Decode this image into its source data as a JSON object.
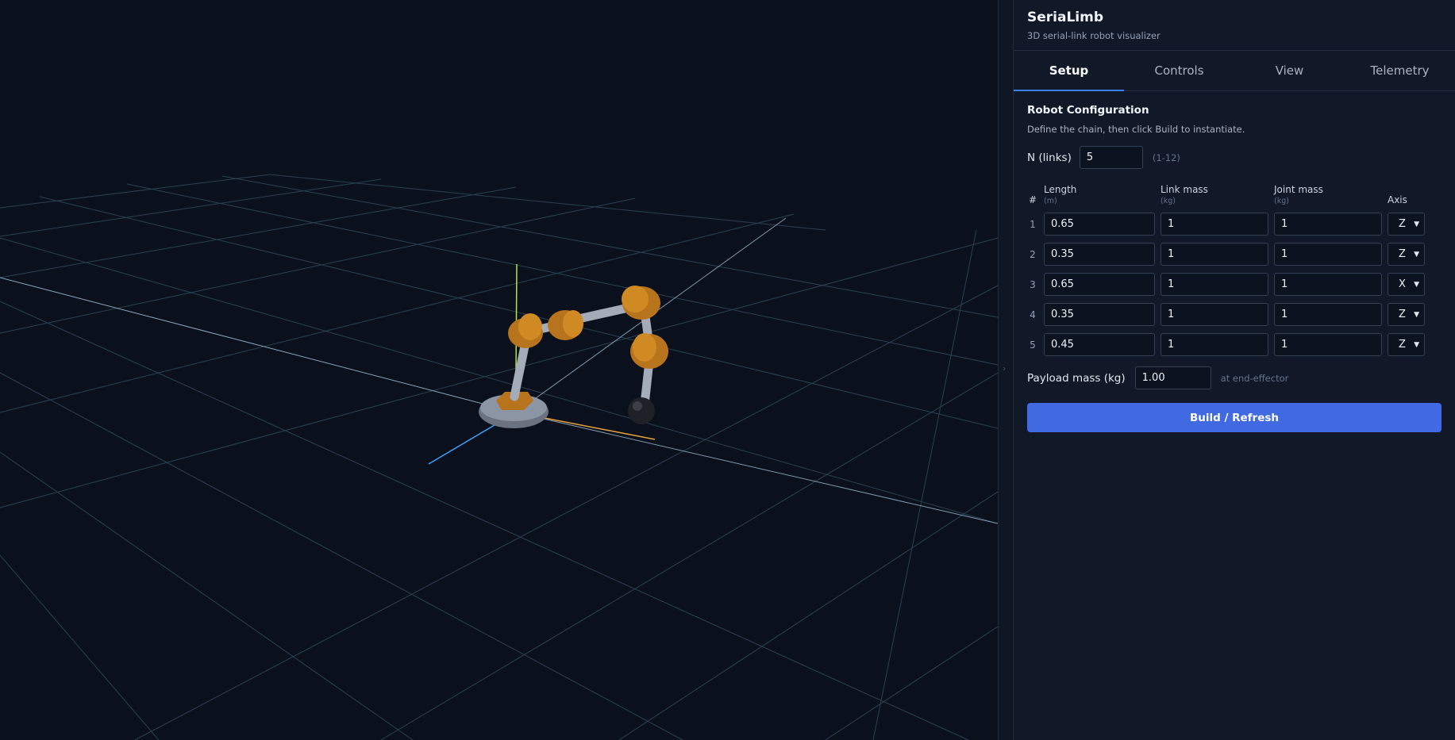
{
  "app": {
    "title": "SeriaLimb",
    "subtitle": "3D serial-link robot visualizer"
  },
  "tabs": [
    {
      "label": "Setup",
      "active": true
    },
    {
      "label": "Controls",
      "active": false
    },
    {
      "label": "View",
      "active": false
    },
    {
      "label": "Telemetry",
      "active": false
    }
  ],
  "setup": {
    "title": "Robot Configuration",
    "description": "Define the chain, then click Build to instantiate.",
    "n_links_label": "N (links)",
    "n_links_value": "5",
    "n_links_hint": "(1-12)",
    "columns": {
      "index": "#",
      "length": "Length",
      "length_unit": "(m)",
      "link_mass": "Link mass",
      "link_mass_unit": "(kg)",
      "joint_mass": "Joint mass",
      "joint_mass_unit": "(kg)",
      "axis": "Axis"
    },
    "rows": [
      {
        "index": "1",
        "length": "0.65",
        "link_mass": "1",
        "joint_mass": "1",
        "axis": "Z"
      },
      {
        "index": "2",
        "length": "0.35",
        "link_mass": "1",
        "joint_mass": "1",
        "axis": "Z"
      },
      {
        "index": "3",
        "length": "0.65",
        "link_mass": "1",
        "joint_mass": "1",
        "axis": "X"
      },
      {
        "index": "4",
        "length": "0.35",
        "link_mass": "1",
        "joint_mass": "1",
        "axis": "Z"
      },
      {
        "index": "5",
        "length": "0.45",
        "link_mass": "1",
        "joint_mass": "1",
        "axis": "Z"
      }
    ],
    "payload_label": "Payload mass (kg)",
    "payload_value": "1.00",
    "payload_hint": "at end-effector",
    "build_label": "Build / Refresh"
  },
  "colors": {
    "accent": "#3b82f6",
    "button": "#4169e1",
    "joint": "#c9801e",
    "link": "#9ca3af",
    "background": "#0b111c"
  },
  "icons": {
    "divider": "chevron-right-icon",
    "select": "chevron-down-icon"
  }
}
